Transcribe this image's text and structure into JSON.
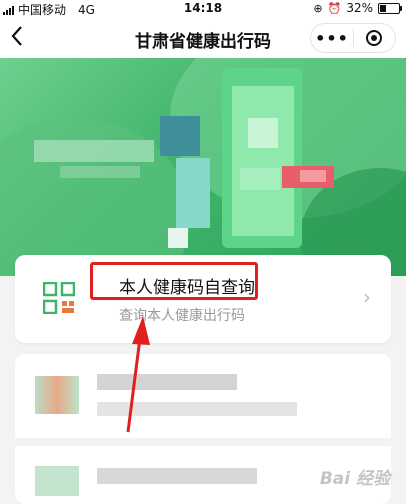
{
  "status_bar": {
    "carrier": "中国移动",
    "network": "4G",
    "time": "14:18",
    "battery": "32%",
    "battery_level": 0.32
  },
  "nav": {
    "title": "甘肃省健康出行码",
    "back_icon": "chevron-left-icon",
    "more_icon": "more-dots-icon",
    "close_icon": "miniprogram-close-icon",
    "more_glyph": "•••"
  },
  "card": {
    "title": "本人健康码自查询",
    "subtitle": "查询本人健康出行码",
    "icon": "qr-code-icon",
    "chevron": "›"
  },
  "watermark": "Bai 经验",
  "colors": {
    "brand_green": "#3fb46a",
    "highlight_red": "#e02020"
  }
}
